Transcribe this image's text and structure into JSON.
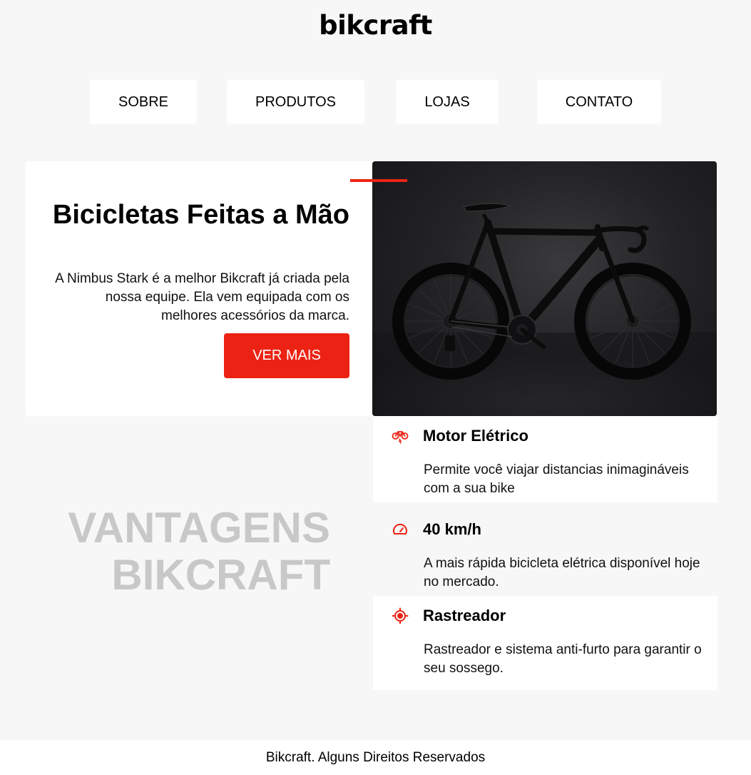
{
  "header": {
    "logo": "bikcraft"
  },
  "nav": {
    "items": [
      {
        "label": "SOBRE"
      },
      {
        "label": "PRODUTOS"
      },
      {
        "label": "LOJAS"
      },
      {
        "label": "CONTATO"
      }
    ]
  },
  "hero": {
    "title": "Bicicletas Feitas a Mão",
    "text": "A Nimbus Stark é a melhor Bikcraft já criada pela nossa equipe. Ela vem equipada com os melhores acessórios da marca.",
    "cta": "VER MAIS",
    "image_icon": "road-bike-photo",
    "accent_color": "#ec2314"
  },
  "advantages": {
    "title": "VANTAGENS BIKCRAFT",
    "features": [
      {
        "icon": "electric-bike-icon",
        "title": "Motor Elétrico",
        "text": "Permite você viajar distancias inimagináveis com a sua bike"
      },
      {
        "icon": "speedometer-icon",
        "title": "40 km/h",
        "text": "A mais rápida bicicleta elétrica disponível hoje no mercado."
      },
      {
        "icon": "target-icon",
        "title": "Rastreador",
        "text": "Rastreador e sistema anti-furto para garantir o seu sossego."
      }
    ]
  },
  "footer": {
    "text": "Bikcraft. Alguns Direitos Reservados"
  },
  "colors": {
    "brand_red": "#ec2314",
    "background": "#f7f7f7",
    "watermark_gray": "#c8c8c8"
  }
}
